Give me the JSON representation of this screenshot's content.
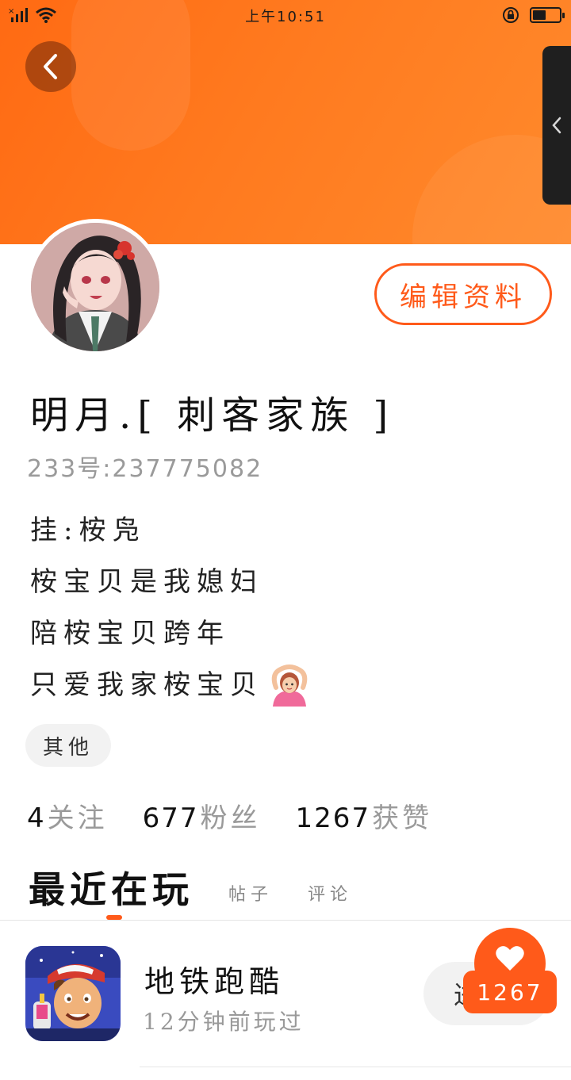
{
  "status_bar": {
    "time": "上午10:51",
    "icons": [
      "no-sim-signal-icon",
      "wifi-icon",
      "rotation-lock-icon",
      "battery-icon"
    ],
    "battery_level": 0.5
  },
  "header": {
    "back_icon": "chevron-left-icon",
    "side_handle_icon": "chevron-left-icon",
    "colors": {
      "banner": "#ff7a1f",
      "accent": "#ff5a1a"
    }
  },
  "profile": {
    "avatar": "avatar-anime-girl",
    "edit_label": "编辑资料",
    "nickname": "明月.[ 刺客家族 ]",
    "uid": "233号:237775082",
    "bio": {
      "line1": "挂:桉凫",
      "line2": "桉宝贝是我媳妇",
      "line3": "陪桉宝贝跨年",
      "line4": "只爱我家桉宝贝"
    },
    "bio_emoji": "person-gesturing-ok-emoji",
    "tag": "其他"
  },
  "stats": {
    "following_num": "4",
    "following_label": "关注",
    "fans_num": "677",
    "fans_label": "粉丝",
    "likes_num": "1267",
    "likes_label": "获赞"
  },
  "tabs": {
    "recent": "最近在玩",
    "posts": "帖子",
    "comments": "评论"
  },
  "games": [
    {
      "name": "地铁跑酷",
      "played": "12分钟前玩过",
      "button": "进"
    }
  ],
  "like_fab": {
    "icon": "heart-icon",
    "count": "1267"
  }
}
